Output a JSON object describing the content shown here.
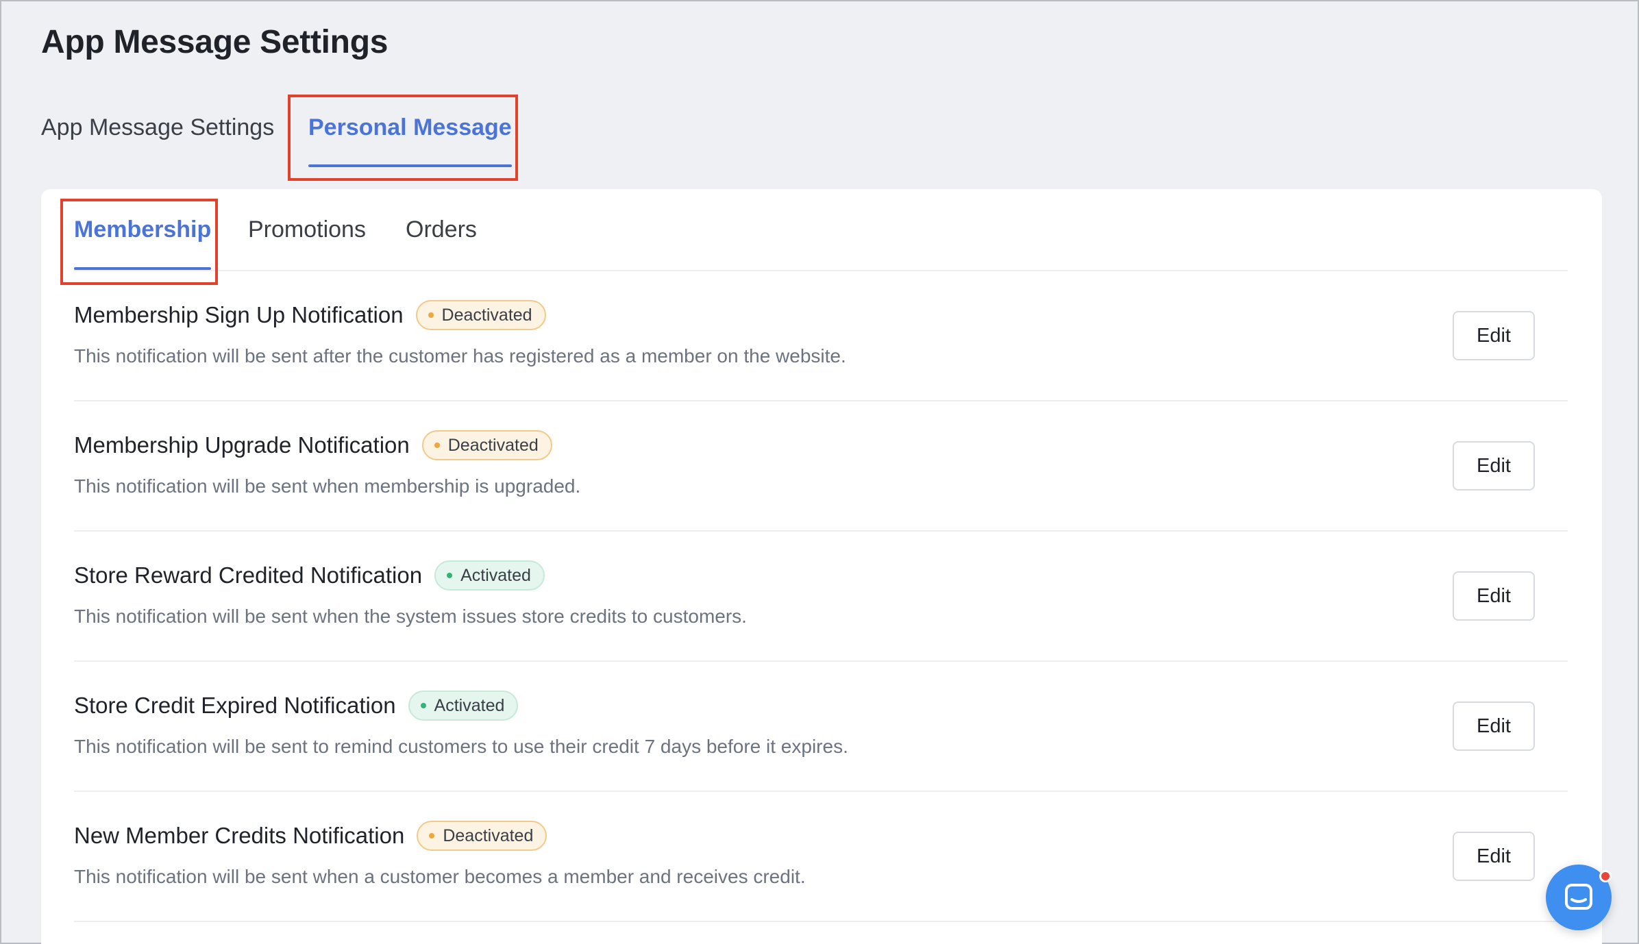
{
  "page": {
    "title": "App Message Settings"
  },
  "top_tabs": [
    {
      "label": "App Message Settings",
      "active": false
    },
    {
      "label": "Personal Message",
      "active": true
    }
  ],
  "sub_tabs": [
    {
      "label": "Membership",
      "active": true
    },
    {
      "label": "Promotions",
      "active": false
    },
    {
      "label": "Orders",
      "active": false
    }
  ],
  "notifications": [
    {
      "title": "Membership Sign Up Notification",
      "status": "Deactivated",
      "status_key": "deactivated",
      "description": "This notification will be sent after the customer has registered as a member on the website.",
      "action": "Edit"
    },
    {
      "title": "Membership Upgrade Notification",
      "status": "Deactivated",
      "status_key": "deactivated",
      "description": "This notification will be sent when membership is upgraded.",
      "action": "Edit"
    },
    {
      "title": "Store Reward Credited Notification",
      "status": "Activated",
      "status_key": "activated",
      "description": "This notification will be sent when the system issues store credits to customers.",
      "action": "Edit"
    },
    {
      "title": "Store Credit Expired Notification",
      "status": "Activated",
      "status_key": "activated",
      "description": "This notification will be sent to remind customers to use their credit 7 days before it expires.",
      "action": "Edit"
    },
    {
      "title": "New Member Credits Notification",
      "status": "Deactivated",
      "status_key": "deactivated",
      "description": "This notification will be sent when a customer becomes a member and receives credit.",
      "action": "Edit"
    }
  ],
  "colors": {
    "accent": "#4b74d6",
    "highlight": "#e0422c",
    "deactivated_dot": "#f0a63a",
    "activated_dot": "#35b27a",
    "chat_button": "#3f8ff0",
    "notification_dot": "#e8453c"
  },
  "icons": {
    "chat": "chat-bubble-icon"
  }
}
